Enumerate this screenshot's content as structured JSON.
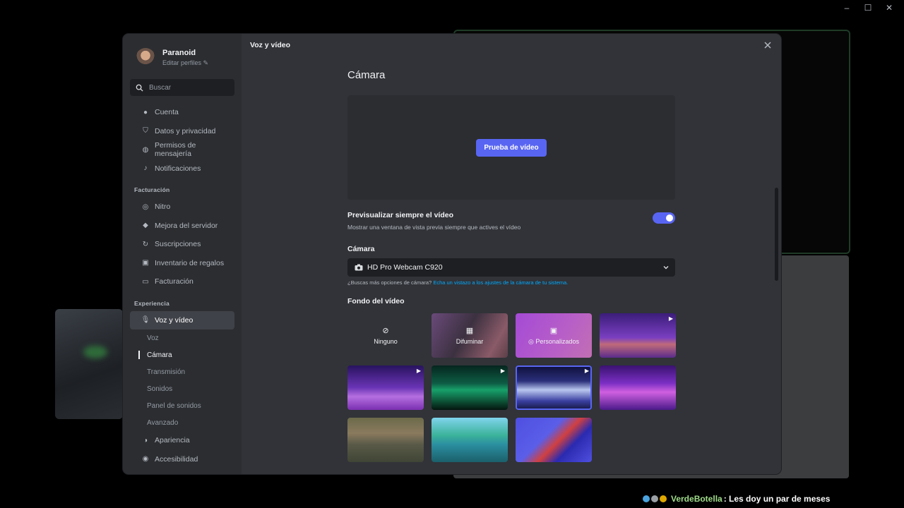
{
  "window": {
    "controls": [
      "–",
      "☐",
      "✕"
    ]
  },
  "profile": {
    "name": "Paranoid",
    "edit": "Editar perfiles"
  },
  "search": {
    "placeholder": "Buscar"
  },
  "sidebar": {
    "user_items": [
      {
        "label": "Cuenta",
        "icon": "person-icon"
      },
      {
        "label": "Datos y privacidad",
        "icon": "shield-icon"
      },
      {
        "label": "Permisos de mensajería",
        "icon": "message-permissions-icon"
      },
      {
        "label": "Notificaciones",
        "icon": "bell-icon"
      }
    ],
    "billing_label": "Facturación",
    "billing_items": [
      {
        "label": "Nitro",
        "icon": "nitro-icon"
      },
      {
        "label": "Mejora del servidor",
        "icon": "boost-icon"
      },
      {
        "label": "Suscripciones",
        "icon": "subscriptions-icon"
      },
      {
        "label": "Inventario de regalos",
        "icon": "gift-icon"
      },
      {
        "label": "Facturación",
        "icon": "billing-icon"
      }
    ],
    "experience_label": "Experiencia",
    "voice_video": "Voz y vídeo",
    "sub_items": [
      "Voz",
      "Cámara",
      "Transmisión",
      "Sonidos",
      "Panel de sonidos",
      "Avanzado"
    ],
    "after_items": [
      {
        "label": "Apariencia",
        "icon": "palette-icon"
      },
      {
        "label": "Accesibilidad",
        "icon": "accessibility-icon"
      }
    ]
  },
  "header": {
    "title": "Voz y vídeo"
  },
  "camera": {
    "heading": "Cámara",
    "test_button": "Prueba de vídeo",
    "toggle_title": "Previsualizar siempre el vídeo",
    "toggle_desc": "Mostrar una ventana de vista previa siempre que actives el vídeo",
    "toggle_on": true,
    "device_label": "Cámara",
    "device_value": "HD Pro Webcam C920",
    "hint_prefix": "¿Buscas más opciones de cámara?",
    "hint_link": "Echa un vistazo a los ajustes de la cámara de tu sistema.",
    "background_label": "Fondo del vídeo",
    "tiles": {
      "none": "Ninguno",
      "blur": "Difuminar",
      "custom": "Personalizados"
    }
  },
  "chat": {
    "user": "VerdeBotella",
    "message": ": Les doy un par de meses"
  },
  "colors": {
    "accent": "#5865f2",
    "link": "#00a8fc",
    "sidebar": "#2b2d31",
    "content": "#313338"
  }
}
